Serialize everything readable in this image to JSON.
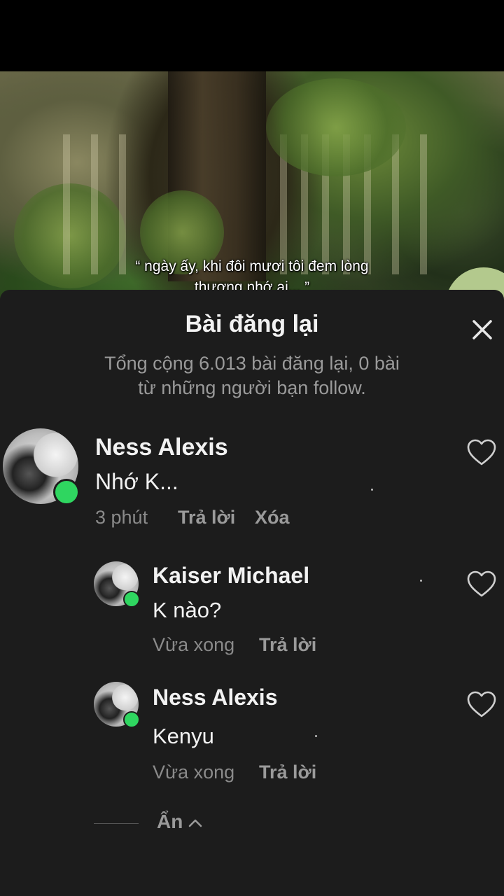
{
  "video": {
    "subtitle_line1": "“ ngày ấy, khi đôi mươi tôi đem lòng",
    "subtitle_line2": "thương nhớ ai... ”"
  },
  "panel": {
    "title": "Bài đăng lại",
    "subtitle_line1": "Tổng cộng 6.013 bài đăng lại, 0 bài",
    "subtitle_line2": "từ những người bạn follow."
  },
  "comments": [
    {
      "name": "Ness Alexis",
      "text": "Nhớ K...",
      "time": "3 phút",
      "reply_label": "Trả lời",
      "delete_label": "Xóa"
    },
    {
      "name": "Kaiser Michael",
      "text": "K nào?",
      "time": "Vừa xong",
      "reply_label": "Trả lời"
    },
    {
      "name": "Ness Alexis",
      "text": "Kenyu",
      "time": "Vừa xong",
      "reply_label": "Trả lời"
    }
  ],
  "hide_label": "Ẩn",
  "colors": {
    "panel_bg": "#1c1c1c",
    "online": "#2fd660",
    "text_primary": "#f2f2f2",
    "text_secondary": "#9a9a9a"
  },
  "icons": [
    "close-icon",
    "heart-icon",
    "chevron-up-icon"
  ]
}
